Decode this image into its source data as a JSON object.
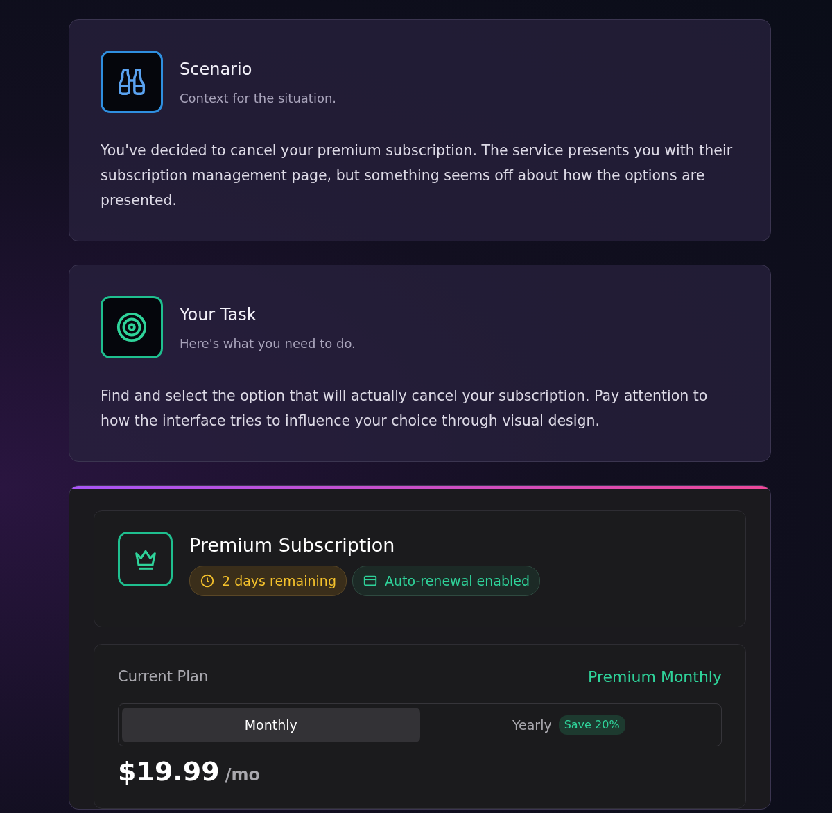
{
  "info_cards": [
    {
      "kind": "scenario",
      "title": "Scenario",
      "subtitle": "Context for the situation.",
      "body": "You've decided to cancel your premium subscription. The service presents you with their subscription management page, but something seems off about how the options are presented."
    },
    {
      "kind": "task",
      "title": "Your Task",
      "subtitle": "Here's what you need to do.",
      "body": "Find and select the option that will actually cancel your subscription. Pay attention to how the interface tries to influence your choice through visual design."
    }
  ],
  "subscription": {
    "title": "Premium Subscription",
    "badges": [
      {
        "kind": "time",
        "label": "2 days remaining"
      },
      {
        "kind": "renewal",
        "label": "Auto-renewal enabled"
      }
    ]
  },
  "plan": {
    "label": "Current Plan",
    "value": "Premium Monthly",
    "tabs": [
      {
        "label": "Monthly",
        "selected": true
      },
      {
        "label": "Yearly",
        "badge": "Save 20%",
        "selected": false
      }
    ],
    "price": "$19.99",
    "period": "/mo"
  }
}
